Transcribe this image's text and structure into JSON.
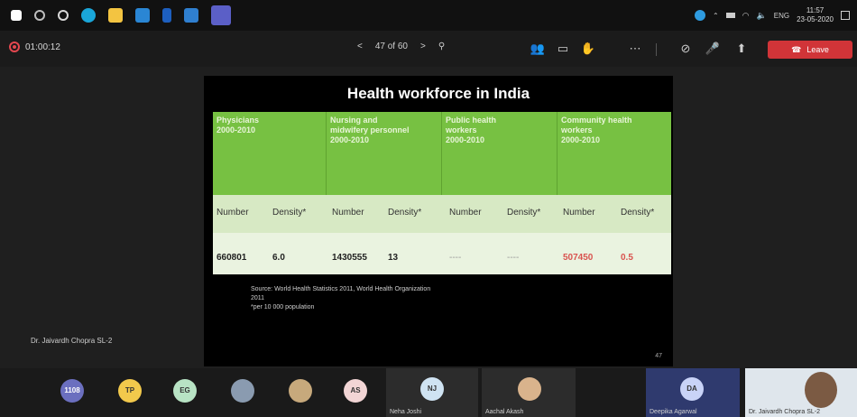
{
  "taskbar": {
    "icons": [
      "windows-icon",
      "search-icon",
      "cortana-icon",
      "edge-icon",
      "file-explorer-icon",
      "store-icon",
      "word-icon",
      "mail-icon",
      "teams-icon"
    ],
    "lang": "ENG",
    "time": "11:57",
    "date": "23-05-2020"
  },
  "meeting": {
    "timer": "01:00:12",
    "page": "47 of 60",
    "leave_label": "Leave"
  },
  "slide": {
    "title": "Health workforce in India",
    "headers": [
      "Physicians\n2000-2010",
      "Nursing and\nmidwifery personnel\n2000-2010",
      "Public health\nworkers\n2000-2010",
      "Community health\nworkers\n2000-2010"
    ],
    "subheaders": [
      "Number",
      "Density*",
      "Number",
      "Density*",
      "Number",
      "Density*",
      "Number",
      "Density*"
    ],
    "values": [
      "660801",
      "6.0",
      "1430555",
      "13",
      "----",
      "----",
      "507450",
      "0.5"
    ],
    "source": "Source: World Health Statistics 2011, World Health Organization",
    "source_year": "2011",
    "footnote": "*per 10 000 population",
    "page_number": "47"
  },
  "presenter": "Dr. Jaivardh Chopra SL-2",
  "participants": [
    {
      "initials": "1108",
      "color": "#6b6fbf"
    },
    {
      "initials": "TP",
      "color": "#f2c94c"
    },
    {
      "initials": "EG",
      "color": "#b8e3c4"
    },
    {
      "initials": "",
      "color": "#8a9bb0"
    },
    {
      "initials": "",
      "color": "#c7a97c"
    },
    {
      "initials": "AS",
      "color": "#f2d5d5"
    }
  ],
  "tiles": [
    {
      "initials": "NJ",
      "name": "Neha Joshi"
    },
    {
      "initials": "",
      "name": "Aachal Akash"
    },
    {
      "initials": "DA",
      "name": "Deepika Agarwal"
    },
    {
      "initials": "",
      "name": "Dr. Jaivardh Chopra SL-2"
    }
  ]
}
